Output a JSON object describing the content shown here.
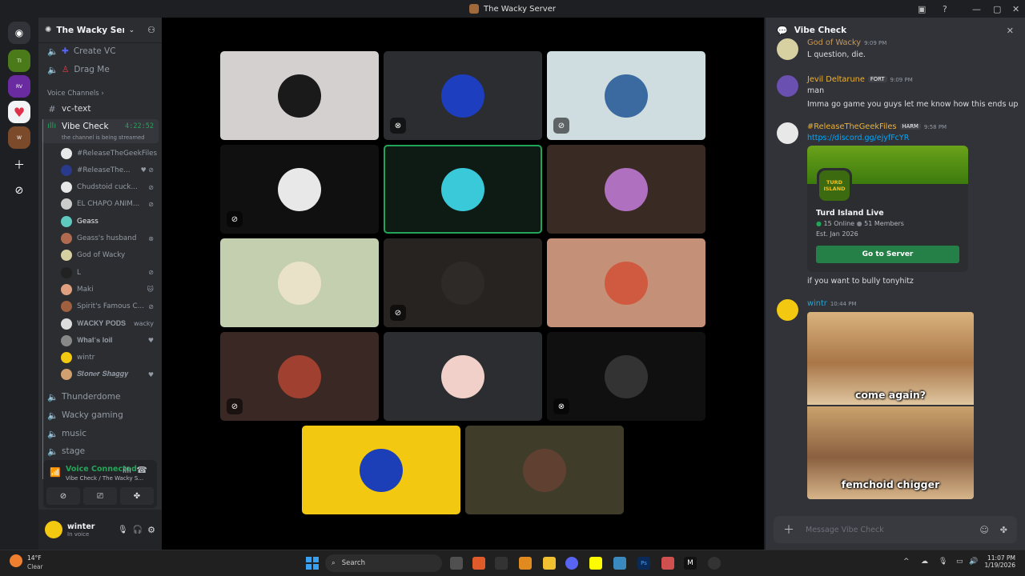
{
  "window": {
    "title": "The Wacky Server"
  },
  "server": {
    "name": "The Wacky Ser...",
    "chevron": "chevron-down-icon",
    "invite_icon": "add-member-icon"
  },
  "sidebar": {
    "top_items": [
      {
        "label": "Create VC",
        "icon": "plus-icon"
      },
      {
        "label": "Drag Me",
        "icon": "person-icon"
      }
    ],
    "category": "Voice Channels",
    "text_channel": "vc-text",
    "active_channel": {
      "name": "Vibe Check",
      "timer": "4:22:52",
      "status": "the channel is being streamed"
    },
    "voice_users": [
      {
        "name": "#ReleaseTheGeekFiles",
        "color": "#e8e8e8",
        "status": ""
      },
      {
        "name": "#ReleaseThe...",
        "color": "#2a3a8a",
        "status": "♥ ⊘"
      },
      {
        "name": "Chudstoid cuck...",
        "color": "#e8e8e8",
        "status": "⊘"
      },
      {
        "name": "EL CHAPO ANIM...",
        "color": "#cccccc",
        "status": "⊘"
      },
      {
        "name": "Geass",
        "color": "#5fc9c0",
        "status": ""
      },
      {
        "name": "Geass's husband",
        "color": "#b06a50",
        "status": "⊗"
      },
      {
        "name": "God of Wacky",
        "color": "#d7d0a0",
        "status": ""
      },
      {
        "name": "L",
        "color": "#222222",
        "status": "⊘"
      },
      {
        "name": "Maki",
        "color": "#e0a080",
        "status": "🐱"
      },
      {
        "name": "Spirit's Famous C...",
        "color": "#a06040",
        "status": "⊘"
      },
      {
        "name": "𝐖𝐀𝐂𝐊𝐘 𝐏𝐎𝐃𝐒",
        "color": "#dddddd",
        "status": "wacky"
      },
      {
        "name": "𝐖𝐡𝐚𝐭'𝐬 𝐥𝐨𝐢𝐥",
        "color": "#888888",
        "status": "♥"
      },
      {
        "name": "wintr",
        "color": "#f2c811",
        "status": ""
      },
      {
        "name": "𝑺𝒕𝒐𝒏𝒆𝒓 𝑺𝒉𝒂𝒈𝒈𝒚",
        "color": "#d0a070",
        "status": "♥"
      }
    ],
    "other_channels": [
      "Thunderdome",
      "Wacky gaming",
      "music",
      "stage"
    ],
    "voice_panel": {
      "title": "Voice Connected",
      "subtitle": "Vibe Check / The Wacky S..."
    },
    "user": {
      "name": "winter",
      "status": "In voice"
    }
  },
  "stage": {
    "tiles": [
      {
        "bg": "#d4d0d0",
        "pic": "#1a1a1a",
        "muted": false
      },
      {
        "bg": "#2b2d31",
        "pic": "#1d3fbf",
        "muted": true,
        "icon": "deafened-icon"
      },
      {
        "bg": "#d0dde0",
        "pic": "#3a6aa0",
        "muted": true,
        "icon": "mic-off-icon"
      },
      {
        "bg": "#101010",
        "pic": "#e8e8e8",
        "muted": true,
        "icon": "mic-off-icon"
      },
      {
        "bg": "#0e1a14",
        "pic": "#39c9d8",
        "muted": false,
        "speaking": true
      },
      {
        "bg": "#3a2a24",
        "pic": "#b070c0",
        "muted": false
      },
      {
        "bg": "#c4cfb0",
        "pic": "#e9e2c8",
        "muted": false
      },
      {
        "bg": "#272320",
        "pic": "#2e2a28",
        "muted": true,
        "icon": "mic-off-icon"
      },
      {
        "bg": "#c49078",
        "pic": "#d05a40",
        "muted": false
      },
      {
        "bg": "#3a2824",
        "pic": "#a04030",
        "muted": true,
        "icon": "mic-off-icon"
      },
      {
        "bg": "#2b2d31",
        "pic": "#f0d0c8",
        "muted": false
      },
      {
        "bg": "#101010",
        "pic": "#333333",
        "muted": true,
        "icon": "deafened-icon"
      },
      {
        "bg": "#f2c811",
        "pic": "#1c3fb8",
        "muted": false
      },
      {
        "bg": "#3f3c2a",
        "pic": "#604030",
        "muted": false
      }
    ]
  },
  "chat": {
    "title": "Vibe Check",
    "messages": [
      {
        "author": "God of Wacky",
        "color": "#c89a5a",
        "time": "9:09 PM",
        "lines": [
          "L question, die."
        ]
      },
      {
        "author": "Jevil Deltarune",
        "color": "#f0b232",
        "tag": "FORT",
        "time": "9:09 PM",
        "lines": [
          "man",
          "Imma go game you guys let me know how this ends up"
        ]
      },
      {
        "author": "#ReleaseTheGeekFiles",
        "color": "#f0b232",
        "tag": "HARM",
        "time": "9:58 PM",
        "lines": [
          "https://discord.gg/ejyfFcYR"
        ]
      },
      {
        "author": "wintr",
        "color": "#23a5d5",
        "time": "10:44 PM",
        "lines": []
      }
    ],
    "invite": {
      "name": "Turd Island Live",
      "online": "15 Online",
      "members": "51 Members",
      "est": "Est. Jan 2026",
      "button": "Go to Server",
      "logo": "TURD ISLAND"
    },
    "after_invite": "if you want to bully tonyhitz",
    "meme": {
      "top": "come again?",
      "bottom": "femchoid chigger"
    },
    "compose_placeholder": "Message Vibe Check"
  },
  "taskbar": {
    "weather_temp": "14°F",
    "weather_text": "Clear",
    "search": "Search",
    "time": "11:07 PM",
    "date": "1/19/2026"
  }
}
